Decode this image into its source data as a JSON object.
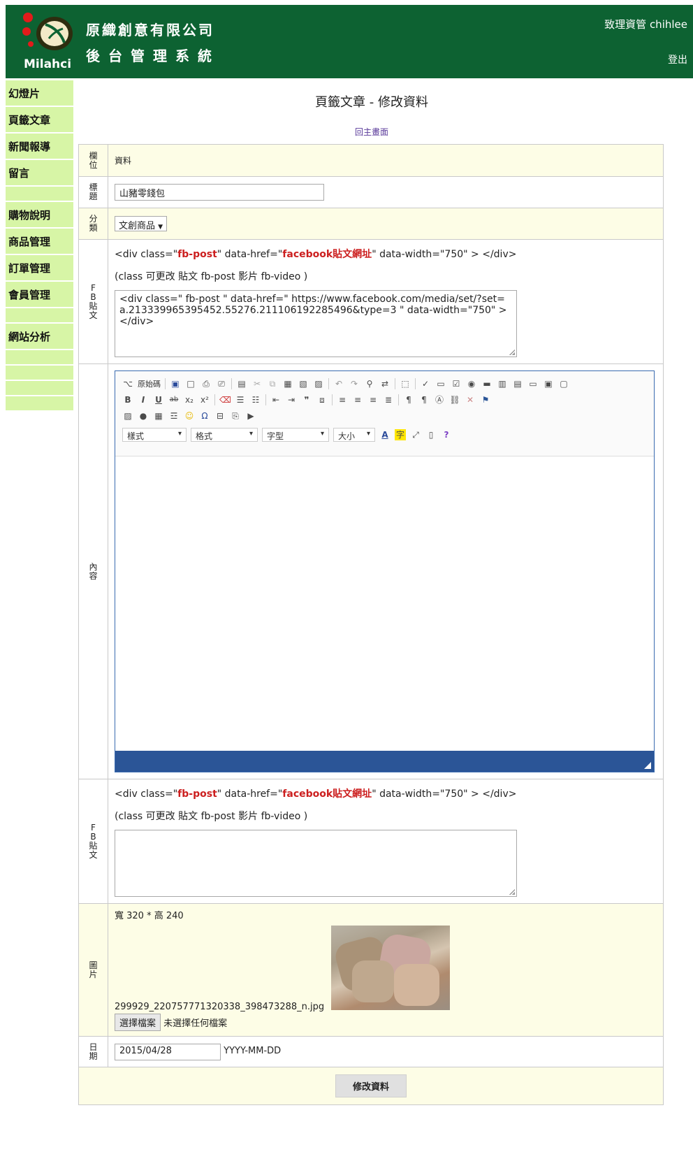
{
  "header": {
    "logo_text": "Milahci",
    "company": "原織創意有限公司",
    "system": "後台管理系統",
    "user": "致理資管 chihlee",
    "logout": "登出"
  },
  "sidebar": {
    "items": [
      "幻燈片",
      "頁籤文章",
      "新聞報導",
      "留言",
      "購物說明",
      "商品管理",
      "訂單管理",
      "會員管理",
      "網站分析"
    ]
  },
  "page": {
    "title": "頁籤文章 - 修改資料",
    "back_link": "回主畫面"
  },
  "form": {
    "header_field": "欄位",
    "header_data": "資料",
    "title_label": "標題",
    "title_value": "山豬零錢包",
    "category_label": "分類",
    "category_value": "文創商品",
    "fb_label": "FB貼文",
    "fb_hint": {
      "part1": "<div class=\"",
      "part2": "fb-post",
      "part3": "\" data-href=\"",
      "part4": "facebook貼文網址",
      "part5": "\" data-width=\"750\" > </div>"
    },
    "fb_hint2": "(class 可更改 貼文 fb-post    影片 fb-video )",
    "fb_value": "<div class=\" fb-post \" data-href=\" https://www.facebook.com/media/set/?set=a.213339965395452.55276.211106192285496&type=3 \" data-width=\"750\" ></div>",
    "content_label": "內容",
    "fb2_value": "",
    "image_label": "圖片",
    "image_size": "寬 320 * 高 240",
    "image_filename": "299929_220757771320338_398473288_n.jpg",
    "file_button": "選擇檔案",
    "file_none": "未選擇任何檔案",
    "date_label": "日期",
    "date_value": "2015/04/28",
    "date_format": "YYYY-MM-DD",
    "submit": "修改資料"
  },
  "editor": {
    "source_label": "原始碼",
    "combo_style": "樣式",
    "combo_format": "格式",
    "combo_font": "字型",
    "combo_size": "大小"
  },
  "colors": {
    "header_bg": "#0d6232",
    "sidebar_bg": "#d7f5a6",
    "row_yellow": "#fdfde6",
    "editor_bar": "#2b5597"
  }
}
